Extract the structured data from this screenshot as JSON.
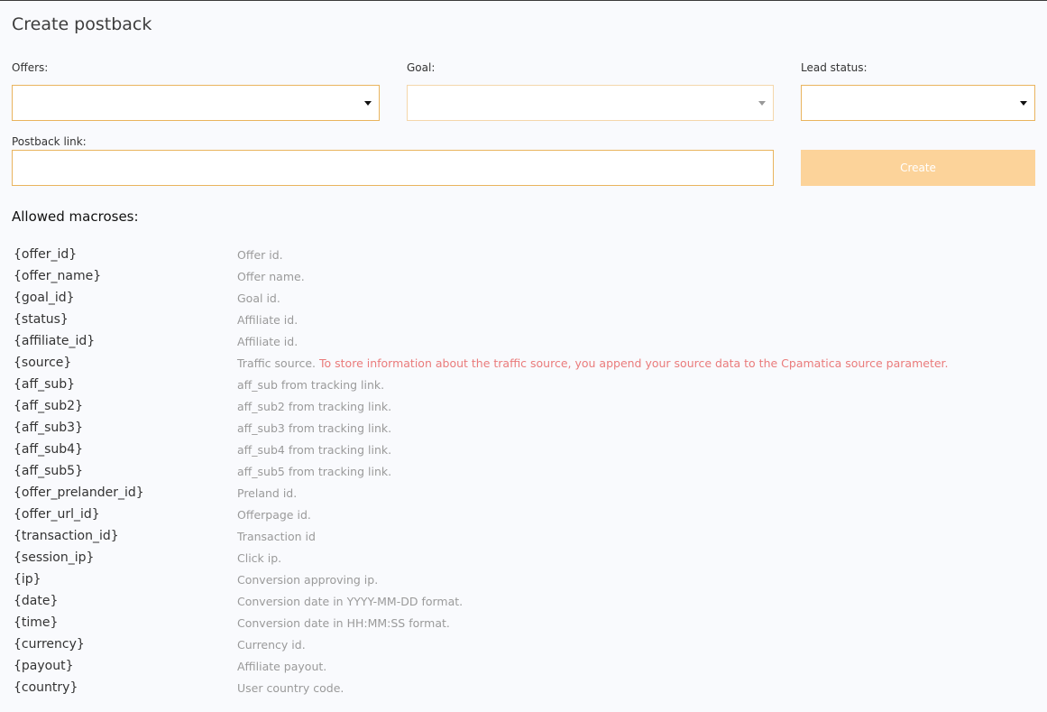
{
  "page": {
    "title": "Create postback"
  },
  "form": {
    "offers_label": "Offers:",
    "goal_label": "Goal:",
    "lead_status_label": "Lead status:",
    "postback_link_label": "Postback link:",
    "offers_value": "",
    "goal_value": "",
    "lead_status_value": "",
    "postback_link_value": "",
    "create_label": "Create"
  },
  "macros": {
    "heading": "Allowed macroses:",
    "items": [
      {
        "key": "{offer_id}",
        "desc": "Offer id."
      },
      {
        "key": "{offer_name}",
        "desc": "Offer name."
      },
      {
        "key": "{goal_id}",
        "desc": "Goal id."
      },
      {
        "key": "{status}",
        "desc": "Affiliate id."
      },
      {
        "key": "{affiliate_id}",
        "desc": "Affiliate id."
      },
      {
        "key": "{source}",
        "desc": "Traffic source.",
        "note": "To store information about the traffic source, you append your source data to the Cpamatica source parameter."
      },
      {
        "key": "{aff_sub}",
        "desc": "aff_sub from tracking link."
      },
      {
        "key": "{aff_sub2}",
        "desc": "aff_sub2 from tracking link."
      },
      {
        "key": "{aff_sub3}",
        "desc": "aff_sub3 from tracking link."
      },
      {
        "key": "{aff_sub4}",
        "desc": "aff_sub4 from tracking link."
      },
      {
        "key": "{aff_sub5}",
        "desc": "aff_sub5 from tracking link."
      },
      {
        "key": "{offer_prelander_id}",
        "desc": "Preland id."
      },
      {
        "key": "{offer_url_id}",
        "desc": "Offerpage id."
      },
      {
        "key": "{transaction_id}",
        "desc": "Transaction id"
      },
      {
        "key": "{session_ip}",
        "desc": "Click ip."
      },
      {
        "key": "{ip}",
        "desc": "Conversion approving ip."
      },
      {
        "key": "{date}",
        "desc": "Conversion date in YYYY-MM-DD format."
      },
      {
        "key": "{time}",
        "desc": "Conversion date in HH:MM:SS format."
      },
      {
        "key": "{currency}",
        "desc": "Currency id."
      },
      {
        "key": "{payout}",
        "desc": "Affiliate payout."
      },
      {
        "key": "{country}",
        "desc": "User country code."
      }
    ]
  },
  "colors": {
    "accent_border": "#e9b45e",
    "button_disabled": "#fcd39a",
    "note_text": "#ea7b7b"
  },
  "icons": {
    "select_caret": "caret-down-icon"
  }
}
